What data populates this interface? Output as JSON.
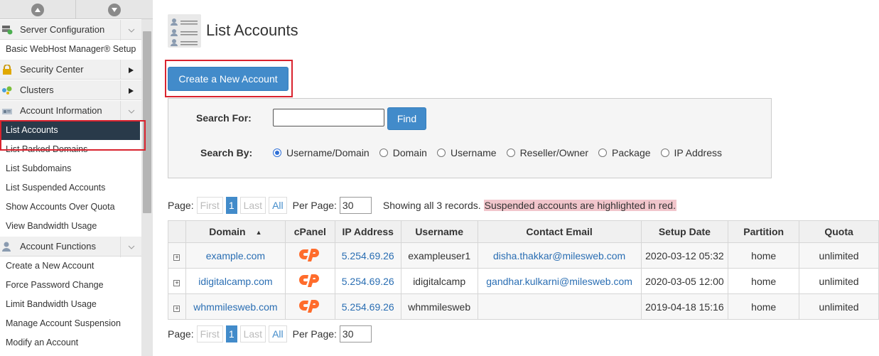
{
  "sidebar": {
    "categories": {
      "server_config": "Server Configuration",
      "security": "Security Center",
      "clusters": "Clusters",
      "account_info": "Account Information",
      "account_functions": "Account Functions"
    },
    "items": {
      "basic_setup": "Basic WebHost Manager® Setup",
      "list_accounts": "List Accounts",
      "list_parked": "List Parked Domains",
      "list_subdomains": "List Subdomains",
      "list_suspended": "List Suspended Accounts",
      "over_quota": "Show Accounts Over Quota",
      "bandwidth_usage": "View Bandwidth Usage",
      "create_account": "Create a New Account",
      "force_password": "Force Password Change",
      "limit_bandwidth": "Limit Bandwidth Usage",
      "manage_suspension": "Manage Account Suspension",
      "modify_account": "Modify an Account"
    },
    "icons": {
      "collapse": "chevron-down-icon",
      "expand": "triangle-right-icon"
    }
  },
  "main": {
    "title": "List Accounts",
    "create_button": "Create a New Account",
    "search": {
      "for_label": "Search For:",
      "by_label": "Search By:",
      "input_value": "",
      "find_button": "Find",
      "options": [
        "Username/Domain",
        "Domain",
        "Username",
        "Reseller/Owner",
        "Package",
        "IP Address"
      ],
      "selected": "Username/Domain"
    },
    "pager": {
      "page_label": "Page:",
      "first": "First",
      "current": "1",
      "last": "Last",
      "all": "All",
      "per_page_label": "Per Page:",
      "per_page_value": "30",
      "records_text": "Showing all 3 records.",
      "suspended_note": "Suspended accounts are highlighted in red."
    },
    "table": {
      "columns": [
        "Domain",
        "cPanel",
        "IP Address",
        "Username",
        "Contact Email",
        "Setup Date",
        "Partition",
        "Quota"
      ],
      "expander_symbol": "+",
      "sort_arrow": "▲",
      "rows": [
        {
          "domain": "example.com",
          "ip": "5.254.69.26",
          "username": "exampleuser1",
          "email": "disha.thakkar@milesweb.com",
          "setup": "2020-03-12 05:32",
          "partition": "home",
          "quota": "unlimited"
        },
        {
          "domain": "idigitalcamp.com",
          "ip": "5.254.69.26",
          "username": "idigitalcamp",
          "email": "gandhar.kulkarni@milesweb.com",
          "setup": "2020-03-05 12:00",
          "partition": "home",
          "quota": "unlimited"
        },
        {
          "domain": "whmmilesweb.com",
          "ip": "5.254.69.26",
          "username": "whmmilesweb",
          "email": "",
          "setup": "2019-04-18 15:16",
          "partition": "home",
          "quota": "unlimited"
        }
      ]
    }
  },
  "colors": {
    "primary_button": "#428bca",
    "active_sidebar": "#293a4a",
    "highlight_box": "#d9232e",
    "suspended_bg": "#f2c6cc",
    "link": "#2a6eb3",
    "cpanel_logo": "#ff6c2c"
  }
}
